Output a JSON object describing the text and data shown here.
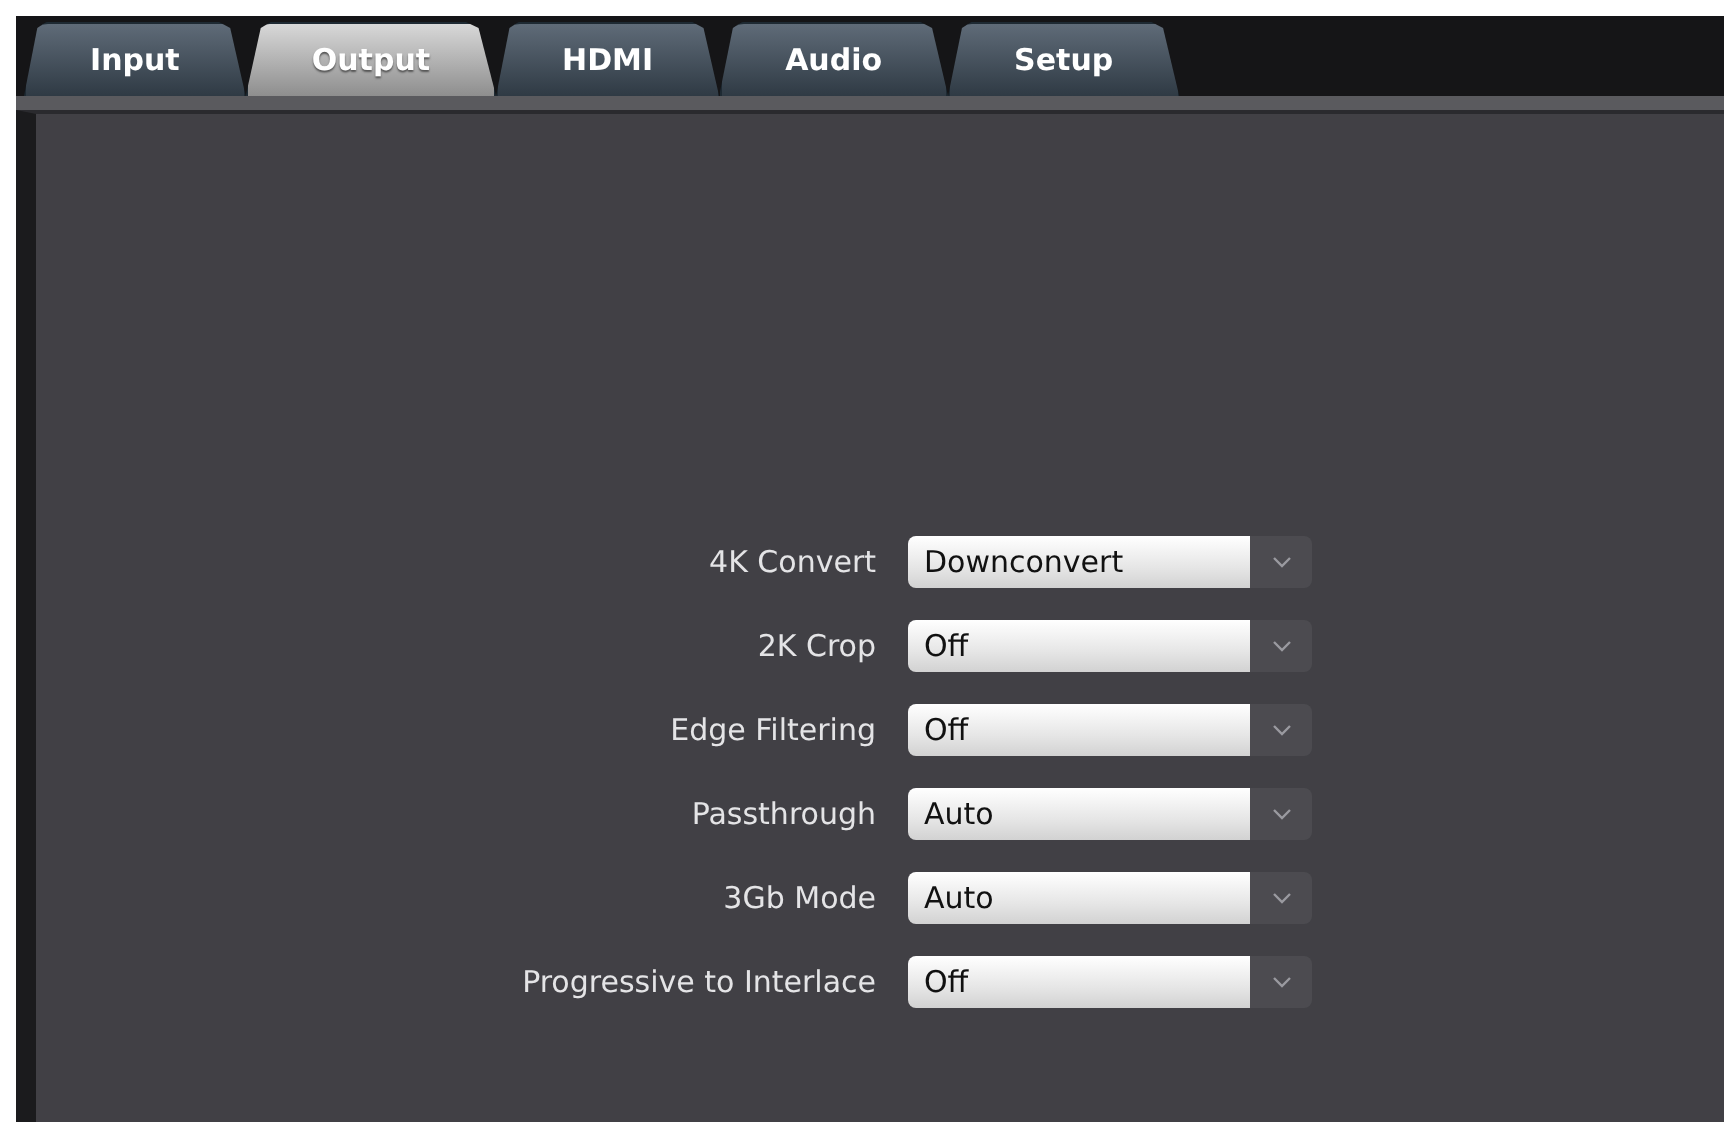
{
  "tabs": [
    {
      "label": "Input",
      "selected": false
    },
    {
      "label": "Output",
      "selected": true
    },
    {
      "label": "HDMI",
      "selected": false
    },
    {
      "label": "Audio",
      "selected": false
    },
    {
      "label": "Setup",
      "selected": false
    }
  ],
  "settings": [
    {
      "label": "4K Convert",
      "value": "Downconvert"
    },
    {
      "label": "2K Crop",
      "value": "Off"
    },
    {
      "label": "Edge Filtering",
      "value": "Off"
    },
    {
      "label": "Passthrough",
      "value": "Auto"
    },
    {
      "label": "3Gb Mode",
      "value": "Auto"
    },
    {
      "label": "Progressive to Interlace",
      "value": "Off"
    }
  ]
}
